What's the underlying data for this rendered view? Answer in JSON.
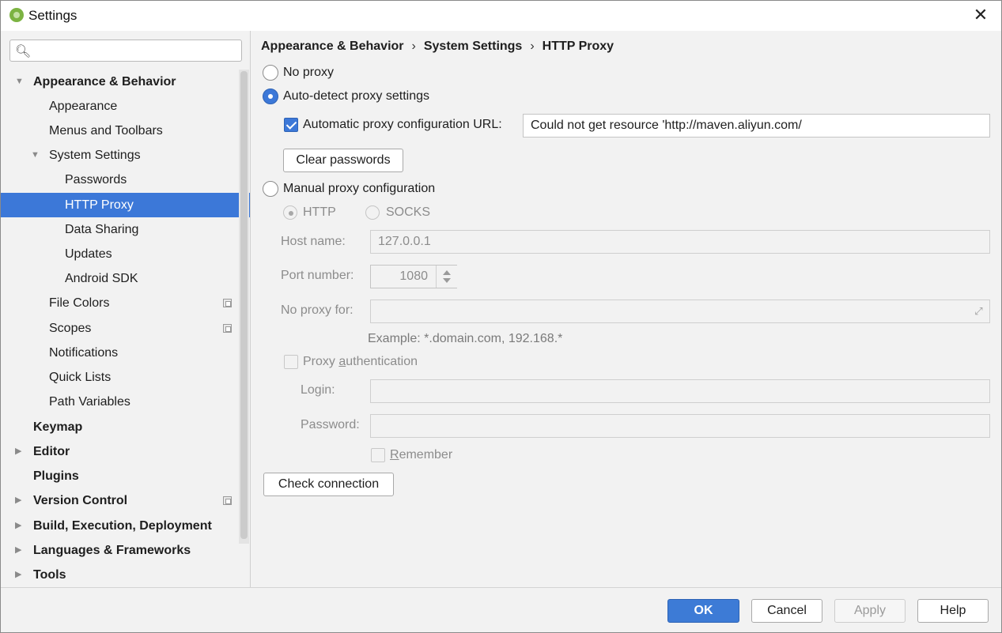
{
  "window": {
    "title": "Settings",
    "close_glyph": "✕"
  },
  "sidebar": {
    "search_placeholder": "",
    "items": [
      {
        "label": "Appearance & Behavior",
        "bold": true,
        "arrow": "▼"
      },
      {
        "label": "Appearance"
      },
      {
        "label": "Menus and Toolbars"
      },
      {
        "label": "System Settings",
        "arrow": "▼"
      },
      {
        "label": "Passwords"
      },
      {
        "label": "HTTP Proxy",
        "selected": true
      },
      {
        "label": "Data Sharing"
      },
      {
        "label": "Updates"
      },
      {
        "label": "Android SDK"
      },
      {
        "label": "File Colors",
        "icon": "copy-icon"
      },
      {
        "label": "Scopes",
        "icon": "copy-icon"
      },
      {
        "label": "Notifications"
      },
      {
        "label": "Quick Lists"
      },
      {
        "label": "Path Variables"
      },
      {
        "label": "Keymap",
        "bold": true
      },
      {
        "label": "Editor",
        "bold": true,
        "arrow": "▶"
      },
      {
        "label": "Plugins",
        "bold": true
      },
      {
        "label": "Version Control",
        "bold": true,
        "arrow": "▶",
        "icon": "copy-icon"
      },
      {
        "label": "Build, Execution, Deployment",
        "bold": true,
        "arrow": "▶"
      },
      {
        "label": "Languages & Frameworks",
        "bold": true,
        "arrow": "▶"
      },
      {
        "label": "Tools",
        "bold": true,
        "arrow": "▶"
      }
    ]
  },
  "breadcrumb": {
    "items": [
      "Appearance & Behavior",
      "System Settings",
      "HTTP Proxy"
    ],
    "separator": "›"
  },
  "proxy": {
    "no_proxy_label": "No proxy",
    "auto_detect_label": "Auto-detect proxy settings",
    "auto_config_url_label": "Automatic proxy configuration URL:",
    "auto_config_url_value": "Could not get resource 'http://maven.aliyun.com/",
    "clear_passwords_label": "Clear passwords",
    "manual_label": "Manual proxy configuration",
    "http_label": "HTTP",
    "socks_label": "SOCKS",
    "host_label": "Host name:",
    "host_value": "127.0.0.1",
    "port_label": "Port number:",
    "port_value": "1080",
    "no_proxy_for_label": "No proxy for:",
    "no_proxy_for_value": "",
    "example_text": "Example: *.domain.com, 192.168.*",
    "proxy_auth_label_pre": "Proxy ",
    "proxy_auth_label_ul": "a",
    "proxy_auth_label_post": "uthentication",
    "login_label": "Login:",
    "login_value": "",
    "password_label": "Password:",
    "password_value": "",
    "remember_label_ul": "R",
    "remember_label_post": "emember",
    "check_connection_label": "Check connection",
    "selected_mode": "auto-detect",
    "auto_config_checked": true
  },
  "footer": {
    "ok_label": "OK",
    "cancel_label": "Cancel",
    "apply_label": "Apply",
    "help_label": "Help"
  },
  "colors": {
    "accent": "#3c78d8",
    "background": "#f2f2f2"
  }
}
